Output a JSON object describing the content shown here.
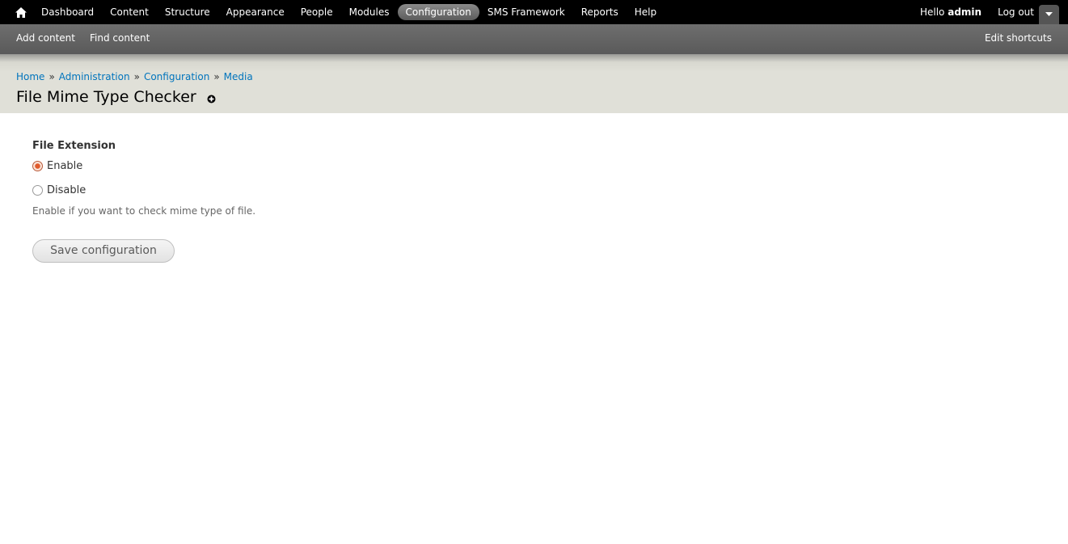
{
  "toolbar": {
    "menu": [
      {
        "label": "Dashboard"
      },
      {
        "label": "Content"
      },
      {
        "label": "Structure"
      },
      {
        "label": "Appearance"
      },
      {
        "label": "People"
      },
      {
        "label": "Modules"
      },
      {
        "label": "Configuration",
        "active": true
      },
      {
        "label": "SMS Framework"
      },
      {
        "label": "Reports"
      },
      {
        "label": "Help"
      }
    ],
    "hello_prefix": "Hello",
    "username": "admin",
    "logout_label": "Log out"
  },
  "shortcuts": {
    "items": [
      "Add content",
      "Find content"
    ],
    "edit_label": "Edit shortcuts"
  },
  "breadcrumb": {
    "items": [
      "Home",
      "Administration",
      "Configuration",
      "Media"
    ],
    "separator": "»"
  },
  "page": {
    "title": "File Mime Type Checker"
  },
  "form": {
    "field_label": "File Extension",
    "options": [
      {
        "label": "Enable",
        "checked": true
      },
      {
        "label": "Disable",
        "checked": false
      }
    ],
    "description": "Enable if you want to check mime type of file.",
    "save_label": "Save configuration"
  },
  "colors": {
    "toolbar_bg": "#000000",
    "shortcut_bg": "#5a5a5a",
    "header_bg": "#e0e0d8",
    "link": "#0074bd",
    "radio_checked": "#e05a2b"
  },
  "icons": {
    "home": "home-icon",
    "drawer": "chevron-down-icon",
    "add_shortcut": "add-shortcut-icon"
  }
}
